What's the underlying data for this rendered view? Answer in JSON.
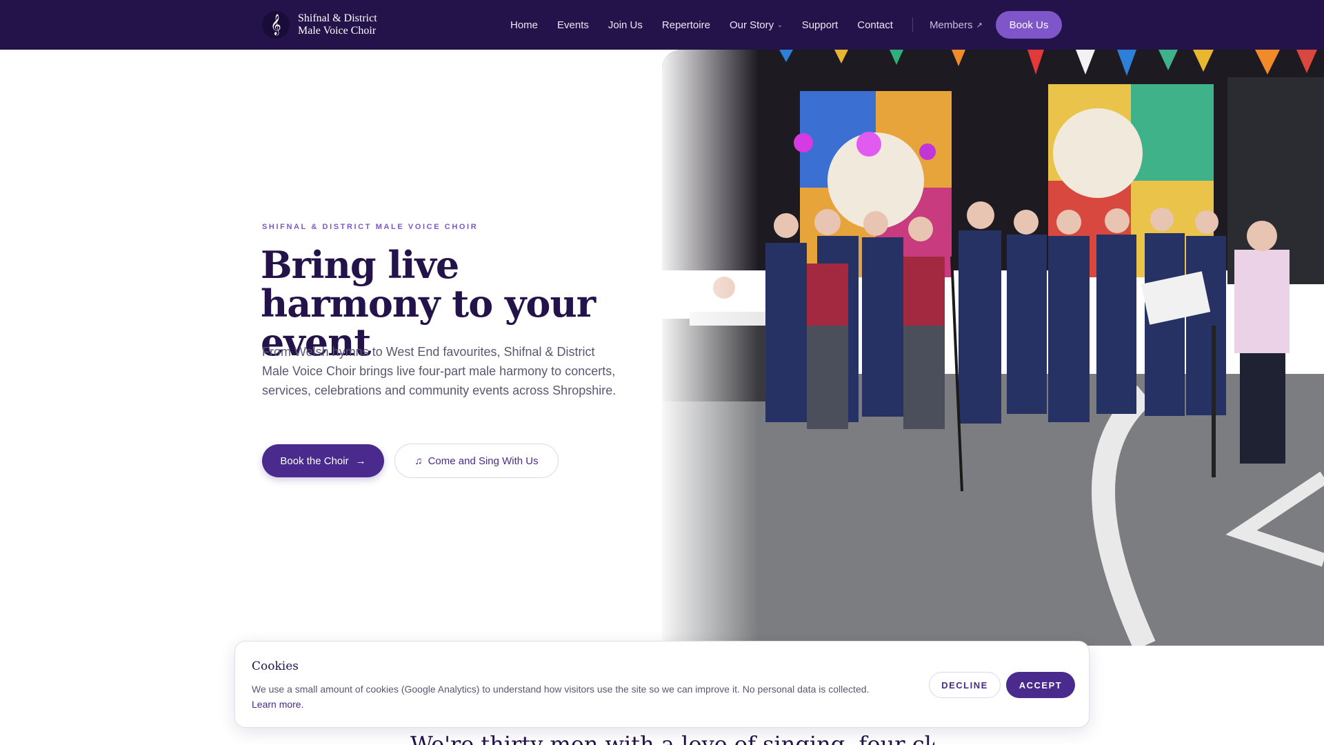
{
  "nav": {
    "brand_line1": "Shifnal & District",
    "brand_line2": "Male Voice Choir",
    "items": [
      {
        "label": "Home"
      },
      {
        "label": "Events"
      },
      {
        "label": "Join Us"
      },
      {
        "label": "Repertoire"
      },
      {
        "label": "Our Story"
      },
      {
        "label": "Support"
      },
      {
        "label": "Contact"
      }
    ],
    "members": "Members",
    "book_us": "Book Us"
  },
  "hero": {
    "eyebrow": "SHIFNAL & DISTRICT MALE VOICE CHOIR",
    "headline": "Bring live harmony to your event",
    "lede": "From Welsh hymns to West End favourites, Shifnal & District Male Voice Choir brings live four-part male harmony to concerts, services, celebrations and community events across Shropshire.",
    "primary_cta": "Book the Choir",
    "secondary_cta": "Come and Sing With Us"
  },
  "below_heading": "We're thirty men with a love of singing, four close-knit",
  "cookies": {
    "title": "Cookies",
    "text": "We use a small amount of cookies (Google Analytics) to understand how visitors use the site so we can improve it. No personal data is collected.",
    "learn_more": "Learn more.",
    "decline": "DECLINE",
    "accept": "ACCEPT"
  },
  "colors": {
    "nav_bg": "#24134a",
    "accent": "#7e56c9",
    "primary": "#4a2a8c",
    "text": "#5b5670"
  },
  "icons": {
    "logo": "treble-clef-icon",
    "dropdown": "chevron-down-icon",
    "external": "arrow-up-right-icon",
    "cta_arrow": "arrow-right-icon",
    "music": "music-note-icon"
  }
}
